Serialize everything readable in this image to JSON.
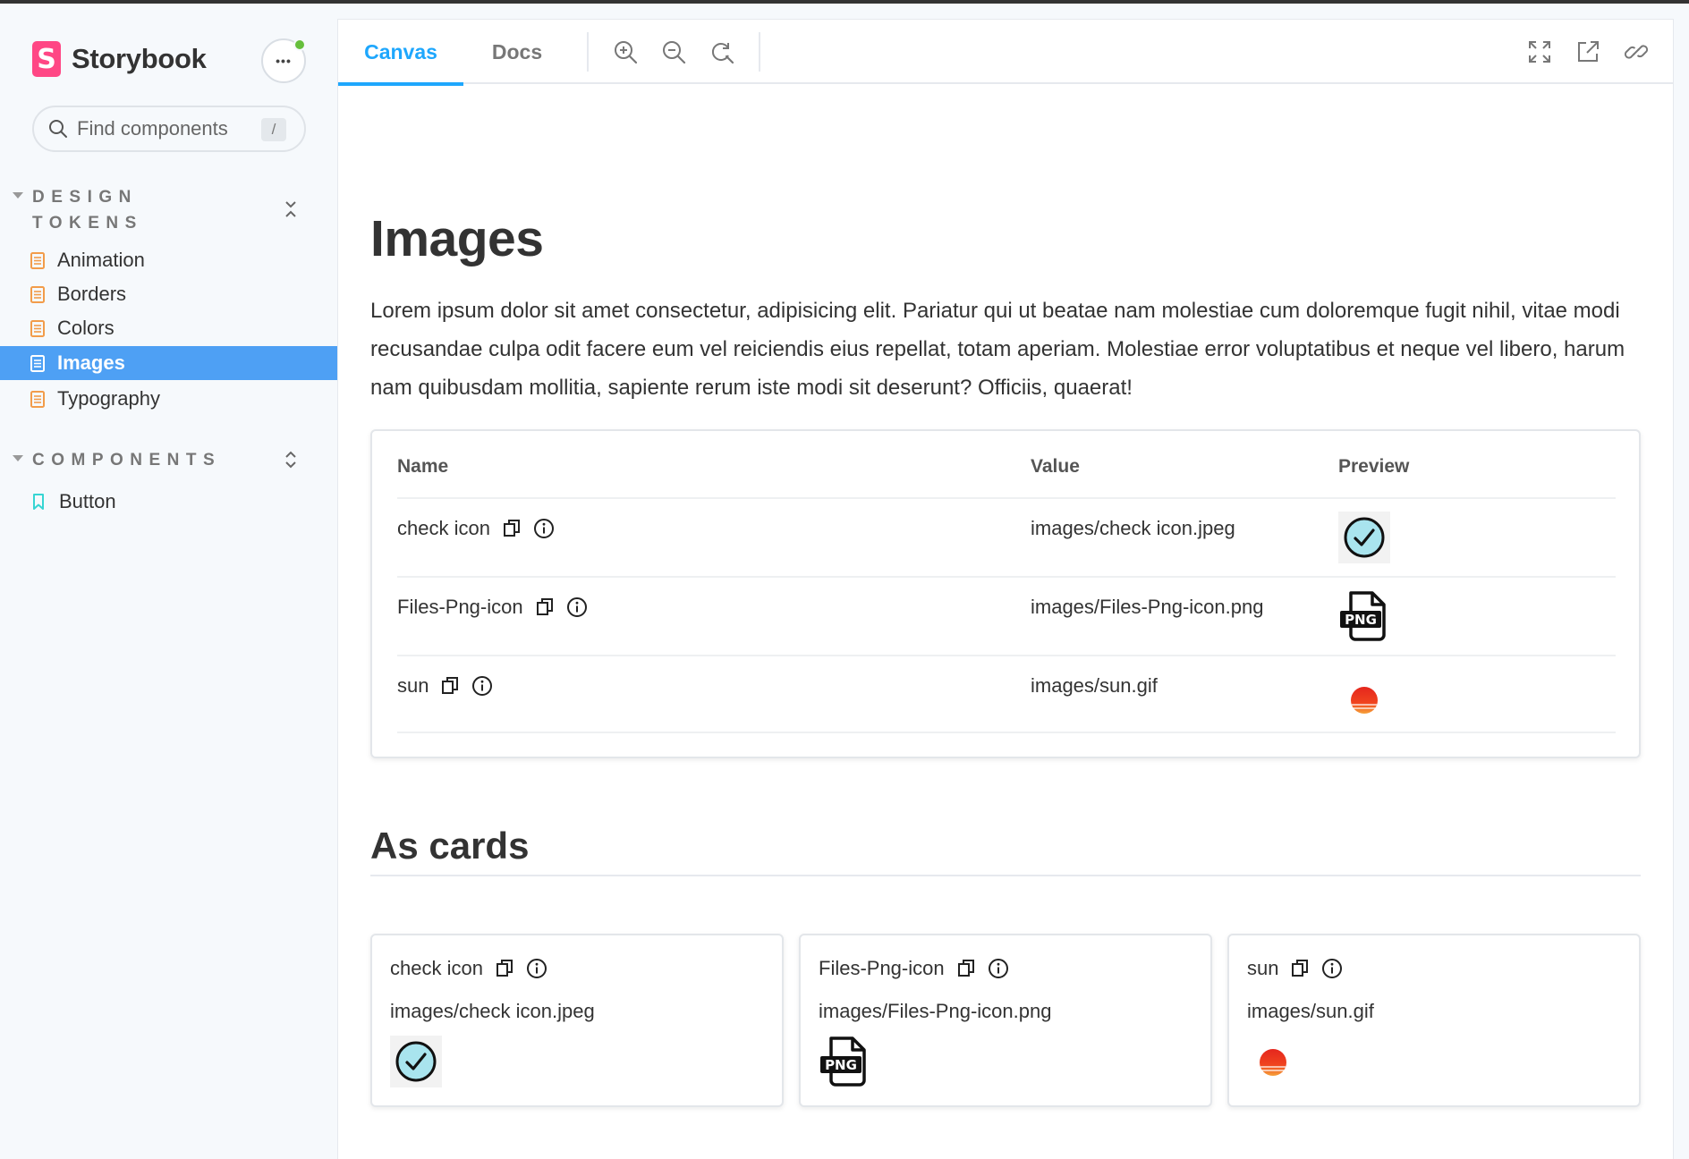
{
  "brand": {
    "name": "Storybook",
    "logo_letter": "S"
  },
  "sidebar": {
    "menu_label": "•••",
    "search": {
      "placeholder": "Find components",
      "shortcut": "/"
    },
    "groups": [
      {
        "label": "DESIGN TOKENS",
        "items": [
          {
            "label": "Animation"
          },
          {
            "label": "Borders"
          },
          {
            "label": "Colors"
          },
          {
            "label": "Images"
          },
          {
            "label": "Typography"
          }
        ]
      },
      {
        "label": "COMPONENTS",
        "items": [
          {
            "label": "Button"
          }
        ]
      }
    ]
  },
  "toolbar": {
    "tabs": [
      {
        "label": "Canvas"
      },
      {
        "label": "Docs"
      }
    ]
  },
  "page": {
    "title": "Images",
    "intro": "Lorem ipsum dolor sit amet consectetur, adipisicing elit. Pariatur qui ut beatae nam molestiae cum doloremque fugit nihil, vitae modi recusandae culpa odit facere eum vel reiciendis eius repellat, totam aperiam. Molestiae error voluptatibus et neque vel libero, harum nam quibusdam mollitia, sapiente rerum iste modi sit deserunt? Officiis, quaerat!",
    "table": {
      "headers": {
        "name": "Name",
        "value": "Value",
        "preview": "Preview"
      },
      "rows": [
        {
          "name": "check icon",
          "value": "images/check icon.jpeg",
          "preview": "check-circle-icon"
        },
        {
          "name": "Files-Png-icon",
          "value": "images/Files-Png-icon.png",
          "preview": "png-file-icon"
        },
        {
          "name": "sun",
          "value": "images/sun.gif",
          "preview": "sun-icon"
        }
      ]
    },
    "cards_title": "As cards",
    "cards": [
      {
        "name": "check icon",
        "value": "images/check icon.jpeg",
        "preview": "check-circle-icon"
      },
      {
        "name": "Files-Png-icon",
        "value": "images/Files-Png-icon.png",
        "preview": "png-file-icon"
      },
      {
        "name": "sun",
        "value": "images/sun.gif",
        "preview": "sun-icon"
      }
    ],
    "png_label": "PNG"
  },
  "colors": {
    "accent": "#1ea7fd",
    "selected": "#4ea0f4",
    "brand": "#ff4785",
    "doc_icon": "#f29c4a",
    "component_icon": "#37d5d3"
  }
}
